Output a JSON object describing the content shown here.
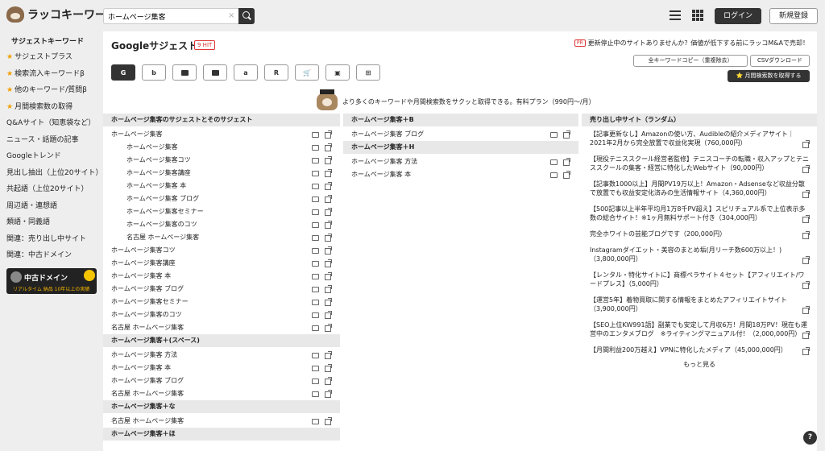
{
  "header": {
    "logo_text": "ラッコキーワード",
    "search_value": "ホームページ集客",
    "clear": "×",
    "login_label": "ログイン",
    "signup_label": "新規登録"
  },
  "sidebar": {
    "title": "サジェストキーワード",
    "items": [
      {
        "label": "サジェストプラス",
        "star": true
      },
      {
        "label": "検索流入キーワードβ",
        "star": true
      },
      {
        "label": "他のキーワード/質問β",
        "star": true
      },
      {
        "label": "月間検索数の取得",
        "star": true
      },
      {
        "label": "Q&Aサイト（知恵袋など）",
        "star": false
      },
      {
        "label": "ニュース・話題の記事",
        "star": false
      },
      {
        "label": "Googleトレンド",
        "star": false
      },
      {
        "label": "見出し抽出（上位20サイト）",
        "star": false
      },
      {
        "label": "共起語（上位20サイト）",
        "star": false
      },
      {
        "label": "周辺語・連想語",
        "star": false
      },
      {
        "label": "類語・同義語",
        "star": false
      },
      {
        "label": "関連：売り出し中サイト",
        "star": false
      },
      {
        "label": "関連：中古ドメイン",
        "star": false
      }
    ],
    "banner": {
      "title": "中古ドメイン",
      "sub": "リアルタイム 納品 10年以上の実績"
    }
  },
  "main": {
    "title": "Googleサジェスト",
    "hit": "9 HIT",
    "pr_badge": "PR",
    "pr_text": "更新停止中のサイトありませんか？価値が低下する前にラッコM&Aで売却！",
    "engines": [
      "G",
      "b",
      "▶",
      "■",
      "a",
      "R",
      "🛒",
      "▣",
      "⊞"
    ],
    "copy_button": "全キーワードコピー（重複除去）",
    "csv_button": "CSVダウンロード",
    "volume_button": "⭐ 月間検索数を取得する",
    "promo": "より多くのキーワードや月間検索数をサクッと取得できる。有料プラン（990円〜/月）"
  },
  "col1": {
    "sections": [
      {
        "title": "ホームページ集客のサジェストとそのサジェスト",
        "rows": [
          {
            "text": "ホームページ集客",
            "indent": false
          },
          {
            "text": "ホームページ集客",
            "indent": true
          },
          {
            "text": "ホームページ集客コツ",
            "indent": true
          },
          {
            "text": "ホームページ集客講座",
            "indent": true
          },
          {
            "text": "ホームページ集客 本",
            "indent": true
          },
          {
            "text": "ホームページ集客 ブログ",
            "indent": true
          },
          {
            "text": "ホームページ集客セミナー",
            "indent": true
          },
          {
            "text": "ホームページ集客のコツ",
            "indent": true
          },
          {
            "text": "名古屋 ホームページ集客",
            "indent": true
          },
          {
            "text": "ホームページ集客コツ",
            "indent": false
          },
          {
            "text": "ホームページ集客講座",
            "indent": false
          },
          {
            "text": "ホームページ集客 本",
            "indent": false
          },
          {
            "text": "ホームページ集客 ブログ",
            "indent": false
          },
          {
            "text": "ホームページ集客セミナー",
            "indent": false
          },
          {
            "text": "ホームページ集客のコツ",
            "indent": false
          },
          {
            "text": "名古屋 ホームページ集客",
            "indent": false
          }
        ]
      },
      {
        "title": "ホームページ集客＋(スペース)",
        "rows": [
          {
            "text": "ホームページ集客 方法",
            "indent": false
          },
          {
            "text": "ホームページ集客 本",
            "indent": false
          },
          {
            "text": "ホームページ集客 ブログ",
            "indent": false
          },
          {
            "text": "名古屋 ホームページ集客",
            "indent": false
          }
        ]
      },
      {
        "title": "ホームページ集客＋な",
        "rows": [
          {
            "text": "名古屋 ホームページ集客",
            "indent": false
          }
        ]
      },
      {
        "title": "ホームページ集客＋ほ",
        "rows": []
      }
    ]
  },
  "col2": {
    "sections": [
      {
        "title": "ホームページ集客＋B",
        "rows": [
          {
            "text": "ホームページ集客 ブログ",
            "indent": false
          }
        ]
      },
      {
        "title": "ホームページ集客＋H",
        "rows": [
          {
            "text": "ホームページ集客 方法",
            "indent": false
          },
          {
            "text": "ホームページ集客 本",
            "indent": false
          }
        ]
      }
    ]
  },
  "col3": {
    "title": "売り出し中サイト（ランダム）",
    "items": [
      "【記事更新なし】Amazonの使い方、Audibleの紹介メディアサイト｜2021年2月から完全放置で収益化実現（760,000円）",
      "【現役テニススクール経営者監修】テニスコーチの転職・収入アップとテニススクールの集客・経営に特化したWebサイト（90,000円）",
      "【記事数1000以上】月間PV19万以上！Amazon・Adsenseなど収益分散で放置でも収益安定化済みの生活情報サイト（4,360,000円）",
      "【500記事以上半年平均月1万8千PV超え】スピリチュアル系で上位表示多数の総合サイト！※1ヶ月無料サポート付き（304,000円）",
      "完全ホワイトの芸能ブログです（200,000円）",
      "Instagramダイエット・美容のまとめ垢(月リーチ数600万以上！)（3,800,000円）",
      "【レンタル・特化サイトに】商標ペラサイト４セット【アフィリエイト/ワードプレス】（5,000円）",
      "【運営5年】着物買取に関する情報をまとめたアフィリエイトサイト（3,900,000円）",
      "【SEO上位KW991語】副業でも安定して月収6万！月間18万PV！現在も運営中のエンタメブログ　※ライティングマニュアル付！（2,000,000円）",
      "【月間利益200万越え】VPNに特化したメディア（45,000,000円）"
    ],
    "more": "もっと見る"
  },
  "help": "?"
}
